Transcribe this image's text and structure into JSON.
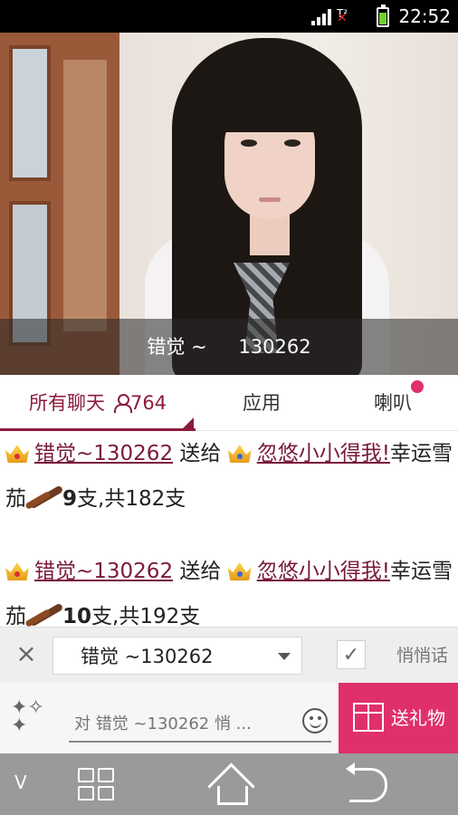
{
  "status_bar": {
    "time": "22:52",
    "battery_color": "#6fd12a"
  },
  "video": {
    "caption_name": "错觉 ~",
    "caption_id": "130262"
  },
  "tabs": {
    "all_chat_label": "所有聊天",
    "all_chat_count": "764",
    "app_label": "应用",
    "horn_label": "喇叭",
    "accent_color": "#8b1c3c",
    "notify_dot_color": "#e0306a"
  },
  "messages": [
    {
      "sender": "错觉~130262",
      "verb": "送给",
      "receiver": "忽悠小小得我!",
      "gift_prefix": "幸运雪茄",
      "amount": "9",
      "total_text": "支,共182支"
    },
    {
      "sender": "错觉~130262",
      "verb": "送给",
      "receiver": "忽悠小小得我!",
      "gift_prefix": "幸运雪茄",
      "amount": "10",
      "total_text": "支,共192支"
    }
  ],
  "target_bar": {
    "close_label": "×",
    "selected_target": "错觉 ~130262",
    "check_mark": "✓",
    "whisper_label": "悄悄话"
  },
  "input_bar": {
    "placeholder": "对 错觉 ~130262 悄 ...",
    "gift_button_label": "送礼物",
    "gift_button_color": "#e0306a"
  },
  "navbar": {
    "v_label": "V"
  }
}
